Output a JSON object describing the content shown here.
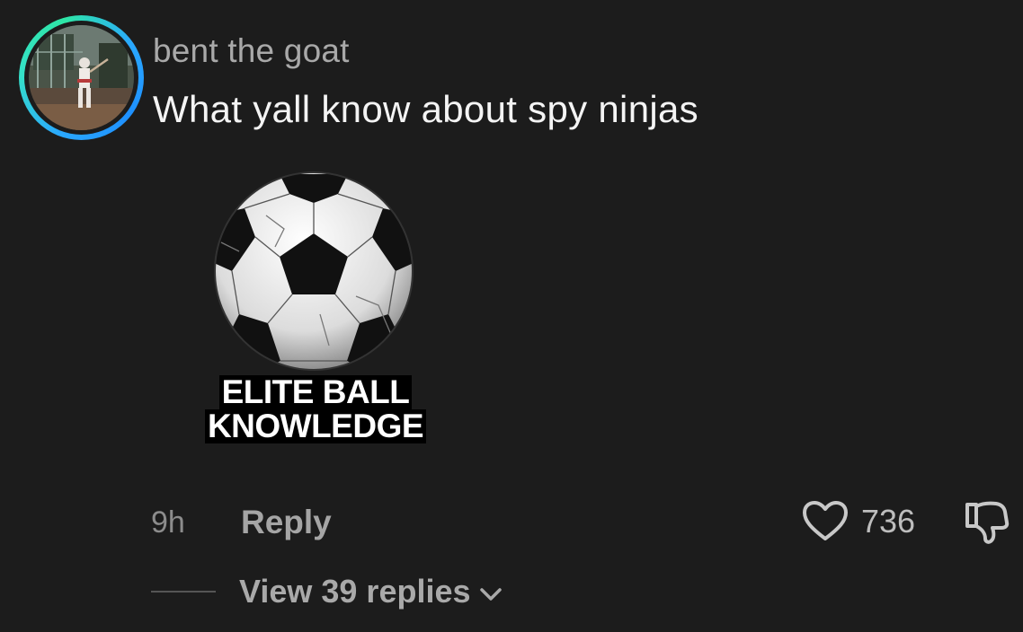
{
  "comment": {
    "username": "bent the goat",
    "text": "What yall know about spy ninjas",
    "sticker": {
      "caption_line1": "ELITE BALL",
      "caption_line2": "KNOWLEDGE",
      "image": "soccer-ball"
    },
    "time": "9h",
    "reply_label": "Reply",
    "like_count": "736",
    "view_replies_label": "View 39 replies",
    "icons": {
      "like": "heart-icon",
      "dislike": "thumbs-down-icon",
      "expand": "chevron-down-icon"
    },
    "colors": {
      "ring_start": "#2aa8ff",
      "ring_end": "#2ee6a6",
      "background": "#1c1c1c"
    }
  }
}
